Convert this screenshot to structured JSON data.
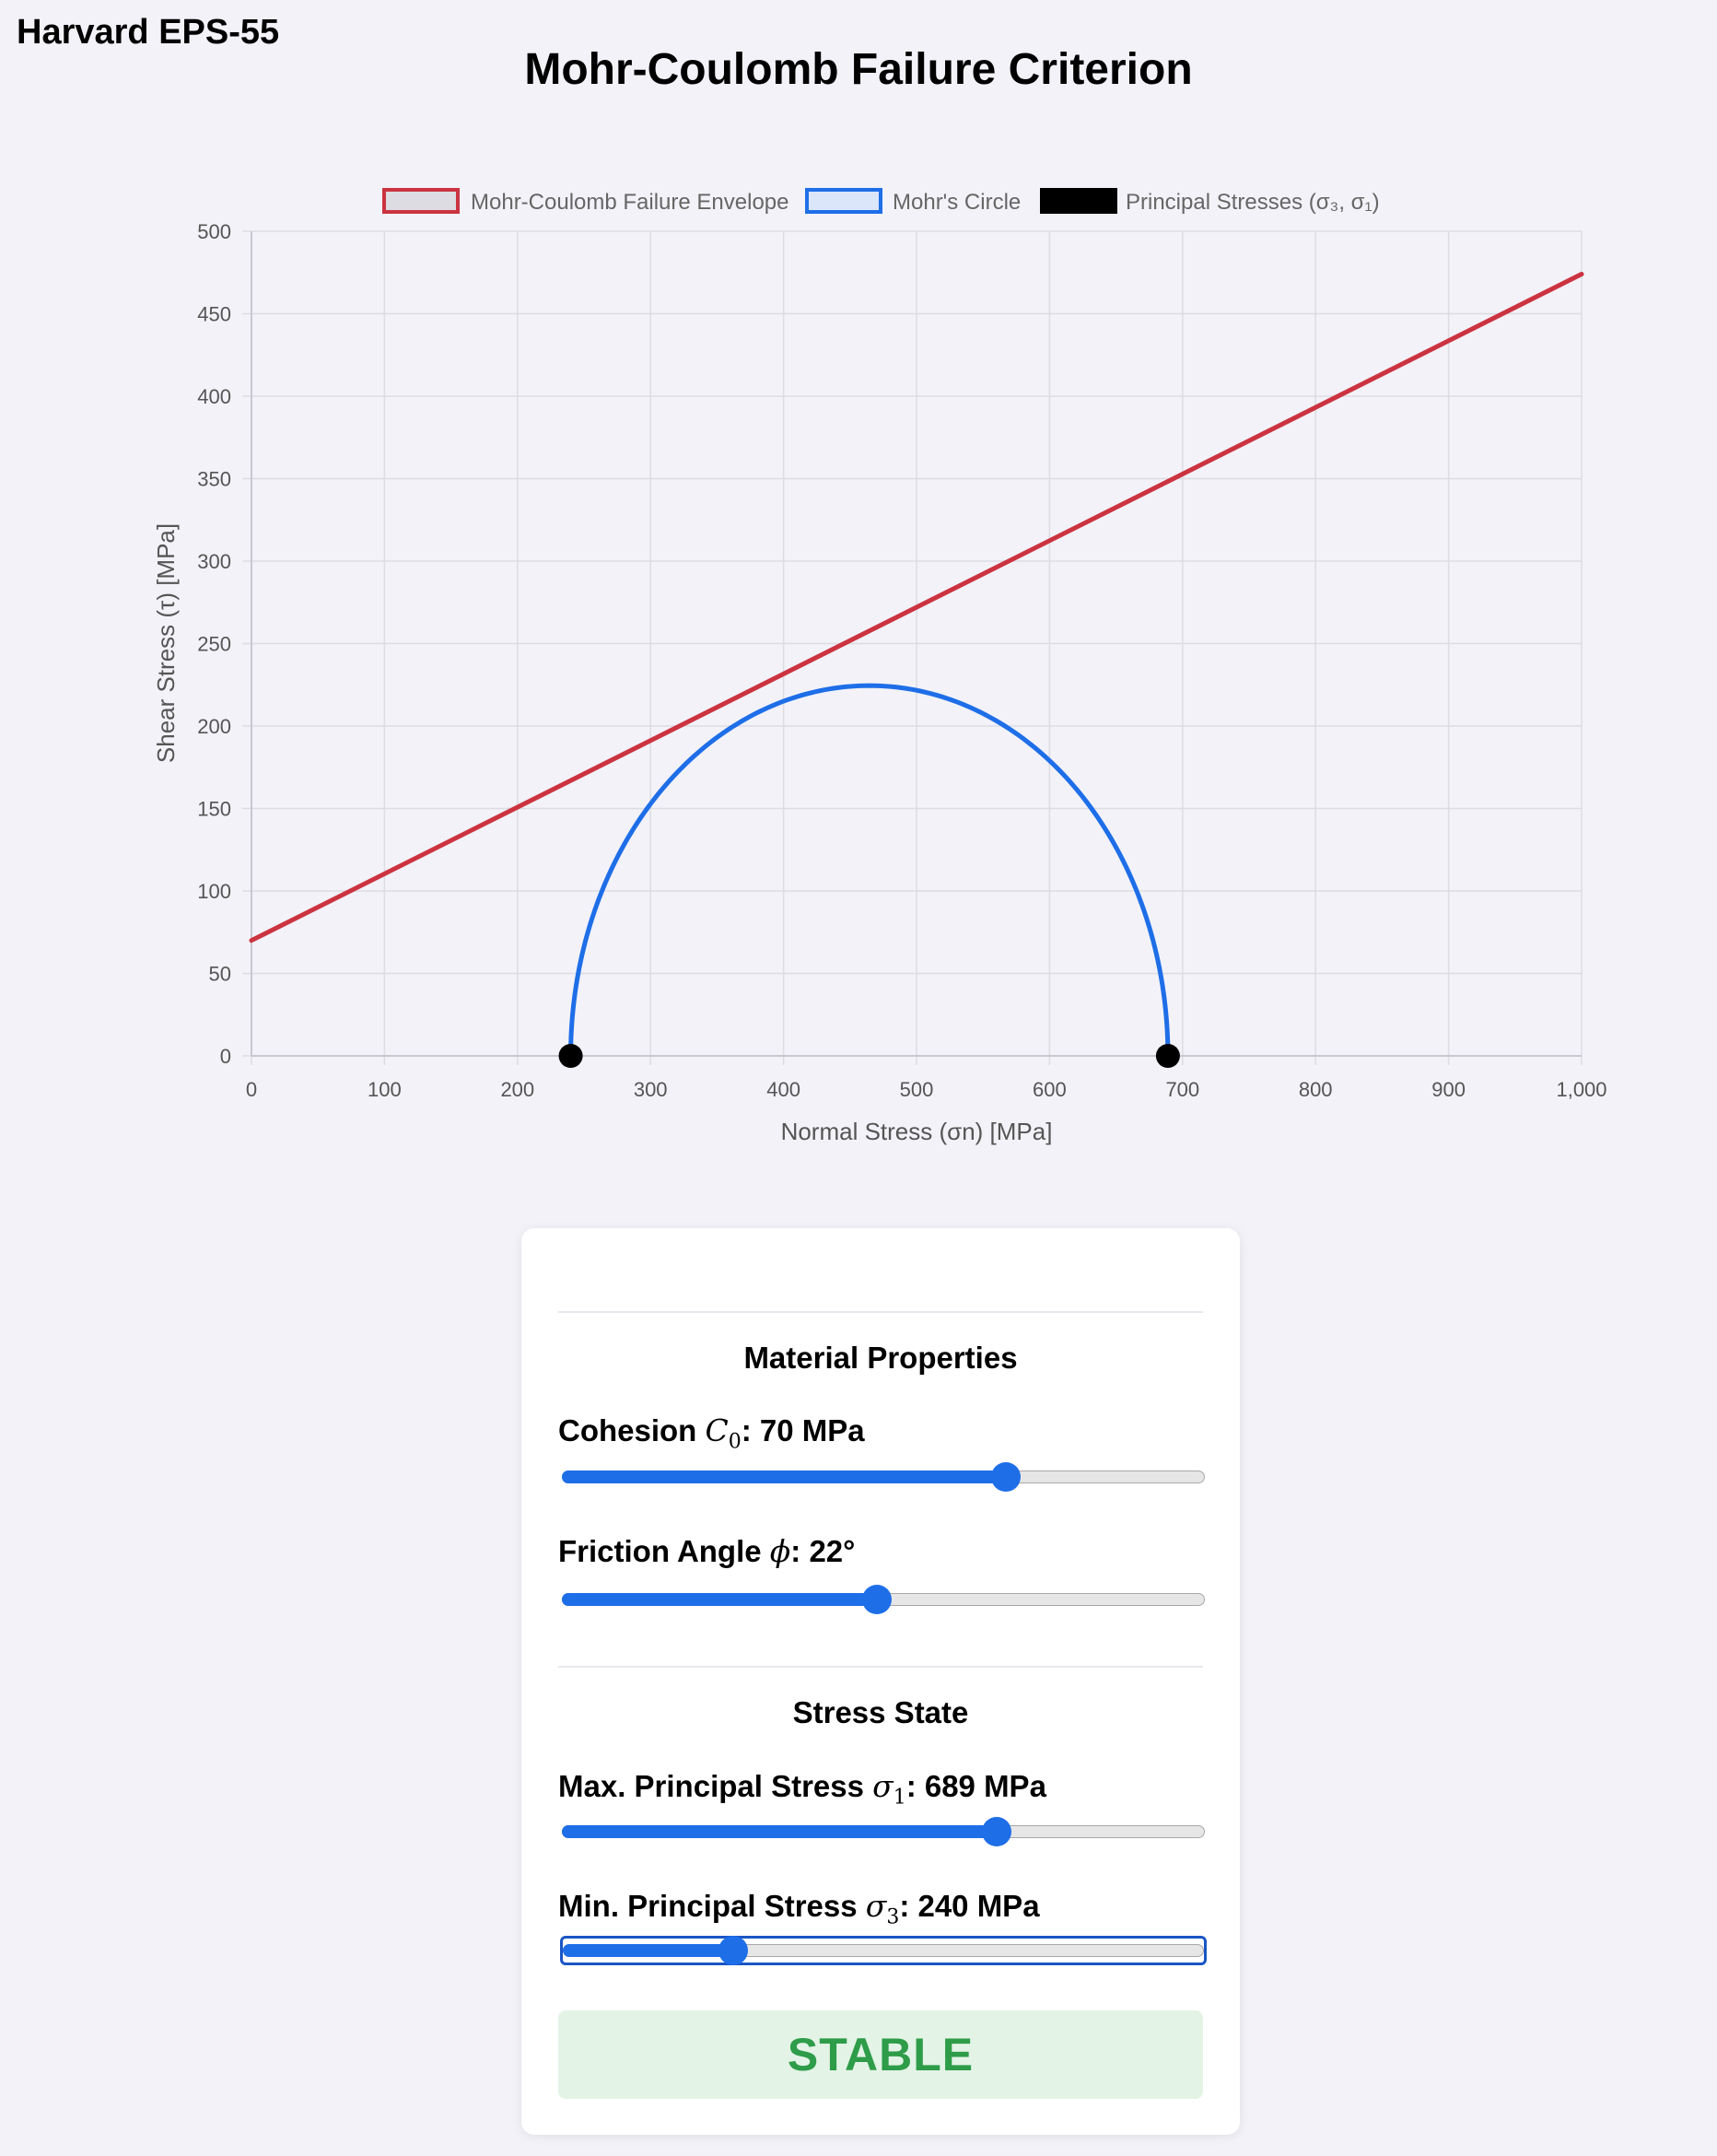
{
  "header": {
    "brand": "Harvard EPS-55",
    "title": "Mohr-Coulomb Failure Criterion"
  },
  "chart_data": {
    "type": "line",
    "xlabel": "Normal Stress (σn) [MPa]",
    "ylabel": "Shear Stress (τ) [MPa]",
    "xlim": [
      0,
      1000
    ],
    "ylim": [
      0,
      500
    ],
    "xticks": [
      0,
      100,
      200,
      300,
      400,
      500,
      600,
      700,
      800,
      900,
      1000
    ],
    "xtick_labels": [
      "0",
      "100",
      "200",
      "300",
      "400",
      "500",
      "600",
      "700",
      "800",
      "900",
      "1,000"
    ],
    "yticks": [
      0,
      50,
      100,
      150,
      200,
      250,
      300,
      350,
      400,
      450,
      500
    ],
    "grid": true,
    "legend_position": "top",
    "legend": [
      "Mohr-Coulomb Failure Envelope",
      "Mohr's Circle",
      "Principal Stresses (σ₃, σ₁)"
    ],
    "series": [
      {
        "name": "Mohr-Coulomb Failure Envelope",
        "kind": "line",
        "color": "#cc3340",
        "x": [
          0,
          1000
        ],
        "y": [
          70,
          474
        ]
      },
      {
        "name": "Mohr's Circle",
        "kind": "semicircle",
        "color": "#1e6ee8",
        "center": 464.5,
        "radius": 224.5
      },
      {
        "name": "Principal Stresses (σ₃, σ₁)",
        "kind": "points",
        "color": "#000000",
        "x": [
          240,
          689
        ],
        "y": [
          0,
          0
        ]
      }
    ]
  },
  "controls": {
    "material_title": "Material Properties",
    "stress_title": "Stress State",
    "sliders": [
      {
        "prefix": "Cohesion ",
        "symbol": "C",
        "sub": "0",
        "suffix": ": 70 MPa",
        "fraction": 0.7
      },
      {
        "prefix": "Friction Angle ",
        "symbol": "ϕ",
        "sub": "",
        "suffix": ": 22°",
        "fraction": 0.49
      },
      {
        "prefix": "Max. Principal Stress ",
        "symbol": "σ",
        "sub": "1",
        "suffix": ": 689 MPa",
        "fraction": 0.684
      },
      {
        "prefix": "Min. Principal Stress ",
        "symbol": "σ",
        "sub": "3",
        "suffix": ": 240 MPa",
        "fraction": 0.255
      }
    ],
    "status": "STABLE",
    "status_color": "#2e9c48"
  }
}
